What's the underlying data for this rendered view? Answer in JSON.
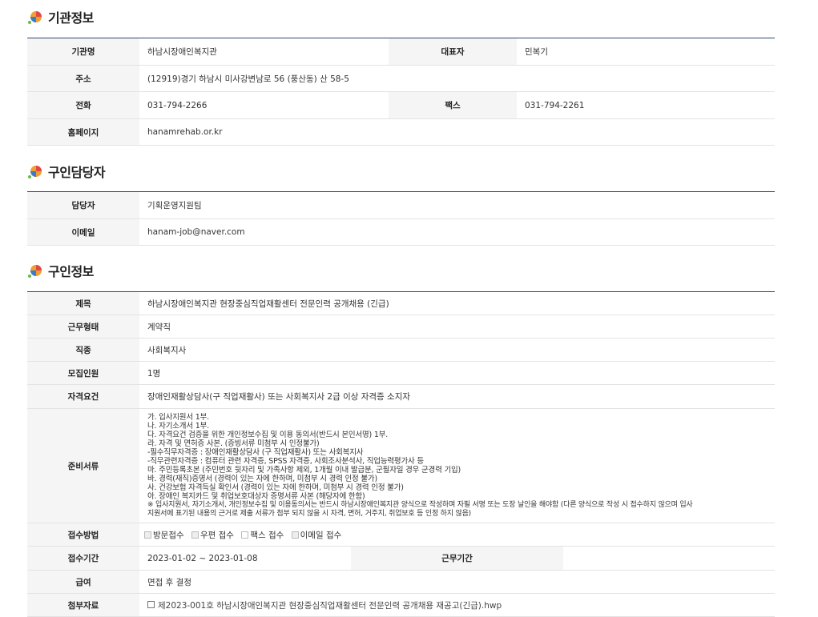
{
  "org": {
    "title": "기관정보",
    "name_label": "기관명",
    "name": "하남시장애인복지관",
    "rep_label": "대표자",
    "rep": "민복기",
    "addr_label": "주소",
    "addr": "(12919)경기 하남시 미사강변남로 56 (풍산동) 산 58-5",
    "tel_label": "전화",
    "tel": "031-794-2266",
    "fax_label": "팩스",
    "fax": "031-794-2261",
    "home_label": "홈페이지",
    "home": "hanamrehab.or.kr"
  },
  "contact": {
    "title": "구인담당자",
    "person_label": "담당자",
    "person": "기획운영지원팀",
    "email_label": "이메일",
    "email": "hanam-job@naver.com"
  },
  "job": {
    "title": "구인정보",
    "subject_label": "제목",
    "subject": "하남시장애인복지관 현장중심직업재활센터 전문인력 공개채용 (긴급)",
    "type_label": "근무형태",
    "type": "계약직",
    "kind_label": "직종",
    "kind": "사회복지사",
    "count_label": "모집인원",
    "count": "1명",
    "req_label": "자격요건",
    "req": "장애인재활상담사(구 직업재활사) 또는 사회복지사 2급 이상 자격증 소지자",
    "docs_label": "준비서류",
    "docs": [
      " 가. 입사지원서 1부.",
      " 나. 자기소개서 1부.",
      " 다. 자격요건 검증을 위한 개인정보수집 및 이용 동의서(반드시 본인서명) 1부.",
      " 라. 자격 및 면허증 사본. (증빙서류 미첨부 시 인정불가)",
      "  -필수직무자격증 : 장애인재활상담사 (구 직업재활사) 또는 사회복지사",
      "  -직무관련자격증 : 컴퓨터 관련 자격증, SPSS 자격증, 사회조사분석사, 직업능력평가사 등",
      " 마. 주민등록초본 (주민번호 뒷자리 및 가족사항 제외, 1개월 이내 발급분, 군필자일 경우 군경력 기입)",
      " 바. 경력(재직)증명서 (경력이 있는 자에 한하며, 미첨부 시 경력 인정 불가)",
      " 사. 건강보험 자격득실 확인서 (경력이 있는 자에 한하며, 미첨부 시 경력 인정 불가)",
      " 아. 장애인 복지카드 및 취업보호대상자 증명서류 사본 (해당자에 한함)",
      " ※ 입사지원서, 자기소개서, 개인정보수집 및 이용동의서는 반드시 하남시장애인복지관 양식으로 작성하며 자필 서명 또는 도장 날인을 해야함 (다른 양식으로 작성 시 접수하지 않으며 입사",
      "지원서에 표기된 내용의 근거로 제출 서류가 첨부 되지 않을 시 자격, 면허, 거주지, 취업보호 등 인정 하지 않음)"
    ],
    "method_label": "접수방법",
    "methods": [
      "방문접수",
      "우편 접수",
      "팩스 접수",
      "이메일 접수"
    ],
    "period_label": "접수기간",
    "period": "2023-01-02 ~ 2023-01-08",
    "workperiod_label": "근무기간",
    "workperiod": "",
    "pay_label": "급여",
    "pay": "면접 후 결정",
    "attach_label": "첨부자료",
    "attach": "제2023-001호 하남시장애인복지관 현장중심직업재활센터 전문인력 공개채용 재공고(긴급).hwp"
  },
  "colors": {
    "header_border": "#2a4a6e",
    "label_bg": "#f5f5f5"
  }
}
